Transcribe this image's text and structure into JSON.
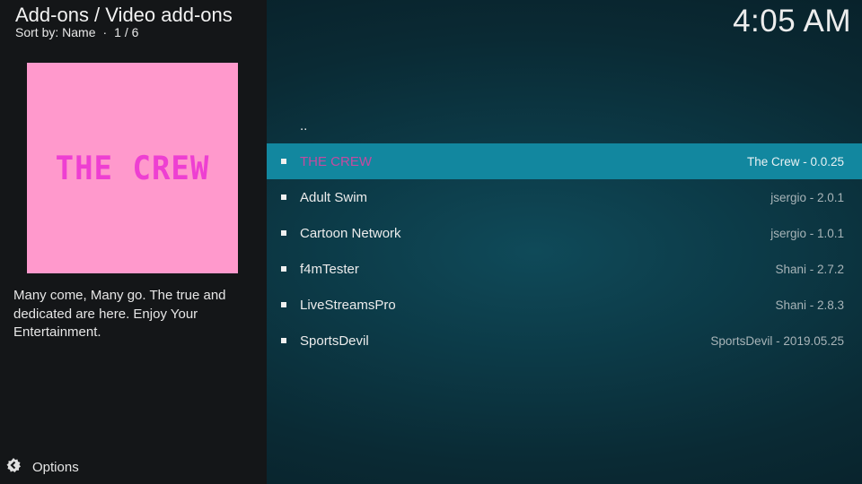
{
  "header": {
    "title": "Add-ons / Video add-ons",
    "sort_label": "Sort by: Name",
    "position": "1 / 6"
  },
  "clock": "4:05 AM",
  "preview": {
    "thumbnail_text": "THE CREW",
    "thumbnail_bg": "#ff99cc",
    "thumbnail_fg": "#ee3fd2",
    "description": "Many come, Many go. The true and dedicated are here. Enjoy Your Entertainment."
  },
  "options": {
    "label": "Options",
    "icon": "options-gear-icon"
  },
  "list": {
    "parent_label": "..",
    "items": [
      {
        "label": "THE CREW",
        "label2": "The Crew - 0.0.25",
        "focused": true
      },
      {
        "label": "Adult Swim",
        "label2": "jsergio - 2.0.1"
      },
      {
        "label": "Cartoon Network",
        "label2": "jsergio - 1.0.1"
      },
      {
        "label": "f4mTester",
        "label2": "Shani - 2.7.2"
      },
      {
        "label": "LiveStreamsPro",
        "label2": "Shani - 2.8.3"
      },
      {
        "label": "SportsDevil",
        "label2": "SportsDevil - 2019.05.25"
      }
    ]
  },
  "colors": {
    "focus_bar": "#12879f",
    "left_panel": "#141618",
    "focused_label": "#c44aa0"
  }
}
